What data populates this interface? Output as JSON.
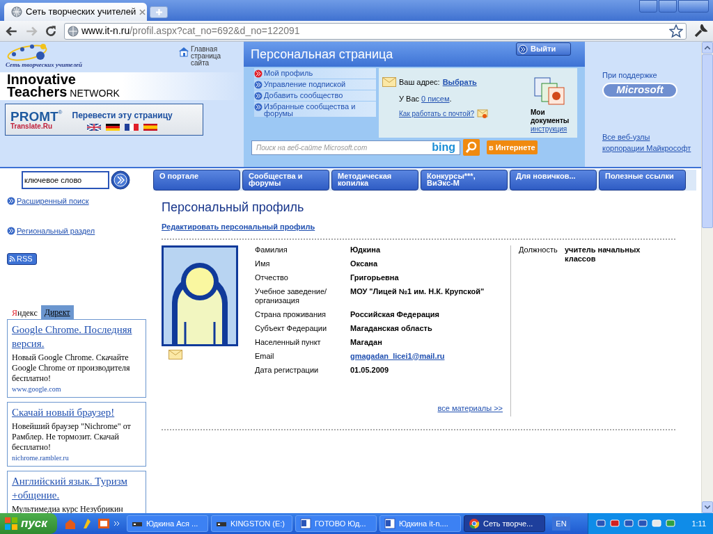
{
  "browser": {
    "tab_title": "Сеть творческих учителей",
    "url_host": "www.it-n.ru",
    "url_path": "/profil.aspx?cat_no=692&d_no=122091"
  },
  "header": {
    "logo_caption": "Сеть творческих учителей",
    "brand_line1": "Innovative",
    "brand_line2": "Teachers",
    "brand_line3": "NETWORK",
    "home_link": "Главная страница сайта",
    "promt": {
      "brand": "PROMT",
      "mark": "®",
      "sub": "Translate.Ru",
      "label": "Перевести эту страницу"
    }
  },
  "personal": {
    "title": "Персональная страница",
    "logout": "Выйти",
    "menu": [
      {
        "label": "Мой профиль",
        "selected": true
      },
      {
        "label": "Управление подпиской",
        "selected": false
      },
      {
        "label": "Добавить сообщество",
        "selected": false
      },
      {
        "label": "Избранные сообщества и форумы",
        "selected": false
      }
    ],
    "mail": {
      "address_label": "Ваш адрес:",
      "address_link": "Выбрать",
      "count_prefix": "У Вас",
      "count_link": "0 писем",
      "count_suffix": ".",
      "help_link": "Как работать с почтой?"
    },
    "docs": {
      "title": "Мои документы",
      "link": "инструкция"
    },
    "search": {
      "placeholder": "Поиск на веб-сайте Microsoft.com",
      "engine": "bing",
      "web_button": "в Интернете"
    }
  },
  "sponsor": {
    "label": "При поддержке",
    "logo": "Microsoft",
    "link": "Все веб-узлы корпорации Майкрософт"
  },
  "site_search": {
    "value": "ключевое слово"
  },
  "nav": [
    "О портале",
    "Сообщества и форумы",
    "Методическая копилка",
    "Конкурсы***, ВиЭкс-М",
    "Для новичков...",
    "Полезные ссылки"
  ],
  "sidebar": {
    "links": [
      "Расширенный поиск",
      "Региональный раздел"
    ],
    "rss": "RSS"
  },
  "ads": {
    "brand": "Яндекс",
    "tab": "Директ",
    "items": [
      {
        "title": "Google Chrome. Последняя версия.",
        "text": "Новый Google Chrome. Скачайте Google Chrome от производителя бесплатно!",
        "url": "www.google.com"
      },
      {
        "title": "Скачай новый браузер!",
        "text": "Новейший браузер \"Nichrome\" от Рамблер. Не тормозит. Скачай бесплатно!",
        "url": "nichrome.rambler.ru"
      },
      {
        "title": "Английский язык. Туризм +общение.",
        "text": "Мультимедиа курс Незубрикин"
      }
    ]
  },
  "profile": {
    "title": "Персональный профиль",
    "edit_link": "Редактировать персональный профиль",
    "fields": [
      {
        "label": "Фамилия",
        "value": "Юдкина",
        "kind": "text"
      },
      {
        "label": "Имя",
        "value": "Оксана",
        "kind": "text"
      },
      {
        "label": "Отчество",
        "value": "Григорьевна",
        "kind": "text"
      },
      {
        "label": "Учебное заведение/ организация",
        "value": "МОУ \"Лицей №1 им. Н.К. Крупской\"",
        "kind": "text"
      },
      {
        "label": "Страна проживания",
        "value": "Российская Федерация",
        "kind": "text"
      },
      {
        "label": "Субъект Федерации",
        "value": "Магаданская область",
        "kind": "text"
      },
      {
        "label": "Населенный пункт",
        "value": "Магадан",
        "kind": "text"
      },
      {
        "label": "Email",
        "value": "gmagadan_licei1@mail.ru",
        "kind": "link"
      },
      {
        "label": "Дата регистрации",
        "value": "01.05.2009",
        "kind": "text"
      }
    ],
    "side_fields": [
      {
        "label": "Должность",
        "value": "учитель начальных классов"
      }
    ],
    "all_materials": "все материалы >>"
  },
  "taskbar": {
    "start": "пуск",
    "items": [
      {
        "label": "Юдкина Ася ...",
        "selected": false,
        "kind": "folder"
      },
      {
        "label": "KINGSTON (E:)",
        "selected": false,
        "kind": "folder"
      },
      {
        "label": "ГОТОВО Юд...",
        "selected": false,
        "kind": "word"
      },
      {
        "label": "Юдкина it-n....",
        "selected": false,
        "kind": "word"
      },
      {
        "label": "Сеть творче...",
        "selected": true,
        "kind": "browser"
      }
    ],
    "lang": "EN",
    "clock": "1:11"
  }
}
